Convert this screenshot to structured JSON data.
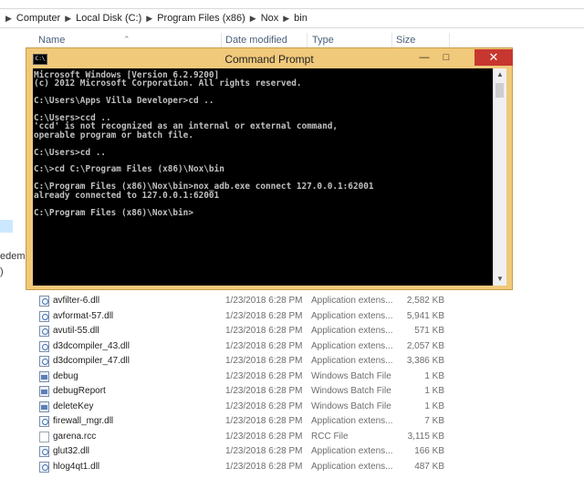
{
  "address": {
    "segments": [
      "Computer",
      "Local Disk (C:)",
      "Program Files (x86)",
      "Nox",
      "bin"
    ]
  },
  "columns": {
    "name": "Name",
    "date": "Date modified",
    "type": "Type",
    "size": "Size"
  },
  "nav": {
    "frag1": "edemi",
    "frag2": ")"
  },
  "cmd": {
    "title": "Command Prompt",
    "icon_text": "C:\\",
    "console": "Microsoft Windows [Version 6.2.9200]\n(c) 2012 Microsoft Corporation. All rights reserved.\n\nC:\\Users\\Apps Villa Developer>cd ..\n\nC:\\Users>ccd ..\n'ccd' is not recognized as an internal or external command,\noperable program or batch file.\n\nC:\\Users>cd ..\n\nC:\\>cd C:\\Program Files (x86)\\Nox\\bin\n\nC:\\Program Files (x86)\\Nox\\bin>nox_adb.exe connect 127.0.0.1:62001\nalready connected to 127.0.0.1:62001\n\nC:\\Program Files (x86)\\Nox\\bin>"
  },
  "files": [
    {
      "name": "avfilter-6.dll",
      "date": "1/23/2018 6:28 PM",
      "type": "Application extens...",
      "size": "2,582 KB",
      "icon": "gear"
    },
    {
      "name": "avformat-57.dll",
      "date": "1/23/2018 6:28 PM",
      "type": "Application extens...",
      "size": "5,941 KB",
      "icon": "gear"
    },
    {
      "name": "avutil-55.dll",
      "date": "1/23/2018 6:28 PM",
      "type": "Application extens...",
      "size": "571 KB",
      "icon": "gear"
    },
    {
      "name": "d3dcompiler_43.dll",
      "date": "1/23/2018 6:28 PM",
      "type": "Application extens...",
      "size": "2,057 KB",
      "icon": "gear"
    },
    {
      "name": "d3dcompiler_47.dll",
      "date": "1/23/2018 6:28 PM",
      "type": "Application extens...",
      "size": "3,386 KB",
      "icon": "gear"
    },
    {
      "name": "debug",
      "date": "1/23/2018 6:28 PM",
      "type": "Windows Batch File",
      "size": "1 KB",
      "icon": "bat"
    },
    {
      "name": "debugReport",
      "date": "1/23/2018 6:28 PM",
      "type": "Windows Batch File",
      "size": "1 KB",
      "icon": "bat"
    },
    {
      "name": "deleteKey",
      "date": "1/23/2018 6:28 PM",
      "type": "Windows Batch File",
      "size": "1 KB",
      "icon": "bat"
    },
    {
      "name": "firewall_mgr.dll",
      "date": "1/23/2018 6:28 PM",
      "type": "Application extens...",
      "size": "7 KB",
      "icon": "gear"
    },
    {
      "name": "garena.rcc",
      "date": "1/23/2018 6:28 PM",
      "type": "RCC File",
      "size": "3,115 KB",
      "icon": "plain"
    },
    {
      "name": "glut32.dll",
      "date": "1/23/2018 6:28 PM",
      "type": "Application extens...",
      "size": "166 KB",
      "icon": "gear"
    },
    {
      "name": "hlog4qt1.dll",
      "date": "1/23/2018 6:28 PM",
      "type": "Application extens...",
      "size": "487 KB",
      "icon": "gear"
    }
  ]
}
